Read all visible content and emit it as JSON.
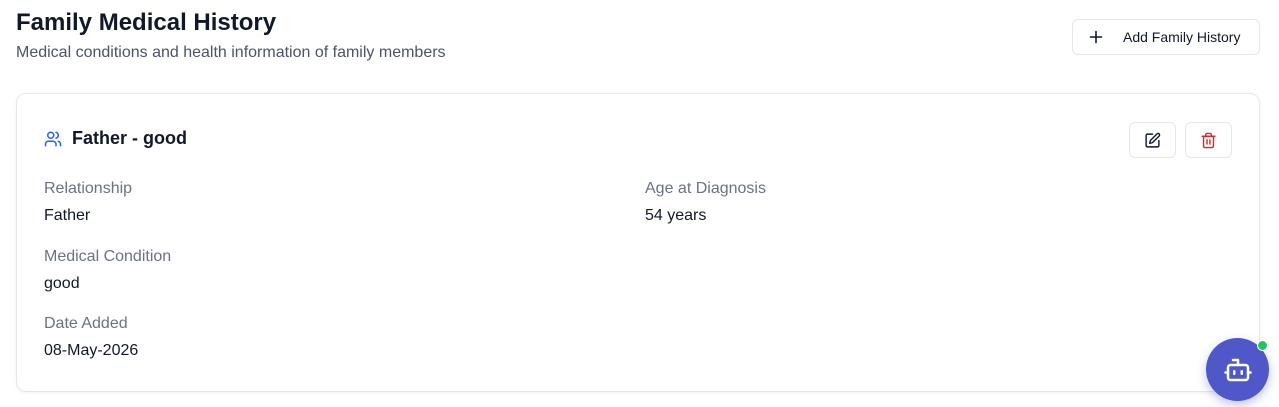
{
  "header": {
    "title": "Family Medical History",
    "subtitle": "Medical conditions and health information of family members",
    "add_button_label": "Add Family History",
    "add_icon": "plus-icon"
  },
  "record": {
    "title": "Father - good",
    "title_icon": "users-icon",
    "edit_icon": "edit-icon",
    "delete_icon": "trash-icon",
    "fields": {
      "relationship": {
        "label": "Relationship",
        "value": "Father"
      },
      "age_at_diagnosis": {
        "label": "Age at Diagnosis",
        "value": "54 years"
      },
      "medical_condition": {
        "label": "Medical Condition",
        "value": "good"
      },
      "date_added": {
        "label": "Date Added",
        "value": "08-May-2026"
      }
    }
  },
  "assistant": {
    "icon": "bot-icon",
    "status": "online"
  },
  "colors": {
    "accent": "#4f57c9",
    "title_icon": "#2563eb",
    "delete": "#dc2626",
    "online": "#22c55e",
    "muted_text": "#6b7280"
  }
}
